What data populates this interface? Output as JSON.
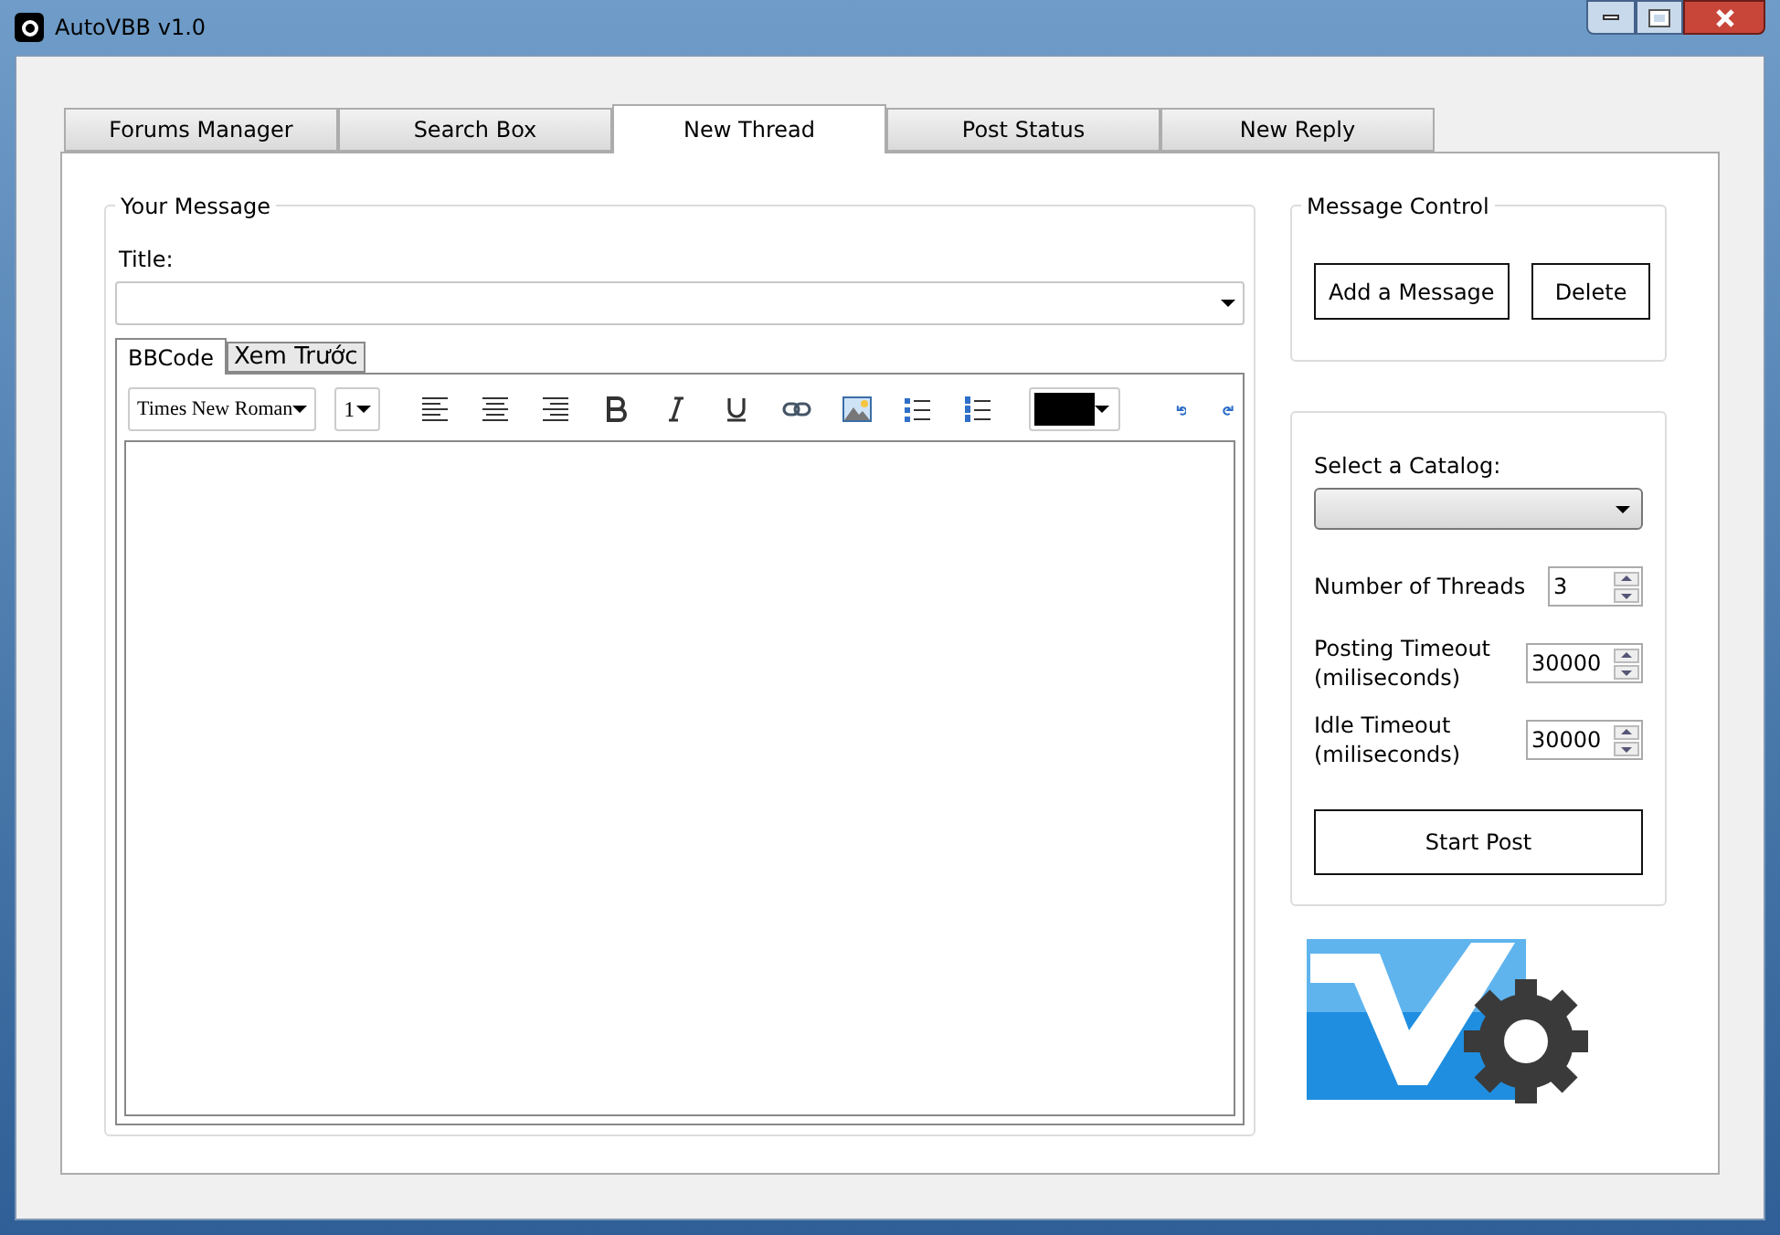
{
  "window": {
    "title": "AutoVBB v1.0"
  },
  "tabs": [
    {
      "label": "Forums Manager",
      "selected": false
    },
    {
      "label": "Search Box",
      "selected": false
    },
    {
      "label": "New Thread",
      "selected": true
    },
    {
      "label": "Post Status",
      "selected": false
    },
    {
      "label": "New Reply",
      "selected": false
    }
  ],
  "your_message": {
    "legend": "Your Message",
    "title_label": "Title:",
    "editor_tabs": [
      {
        "label": "BBCode",
        "selected": true
      },
      {
        "label": "Xem Trước",
        "selected": false
      }
    ],
    "font": "Times New Roman",
    "size": "1"
  },
  "message_control": {
    "legend": "Message Control",
    "buttons": [
      "Add a Message",
      "Delete"
    ]
  },
  "settings": {
    "catalog_label": "Select a Catalog:",
    "spinners": [
      {
        "label": "Number of Threads",
        "value": "3"
      },
      {
        "label": "Posting Timeout (miliseconds)",
        "value": "30000"
      },
      {
        "label": "Idle Timeout (miliseconds)",
        "value": "30000"
      }
    ],
    "start_button": "Start Post"
  }
}
